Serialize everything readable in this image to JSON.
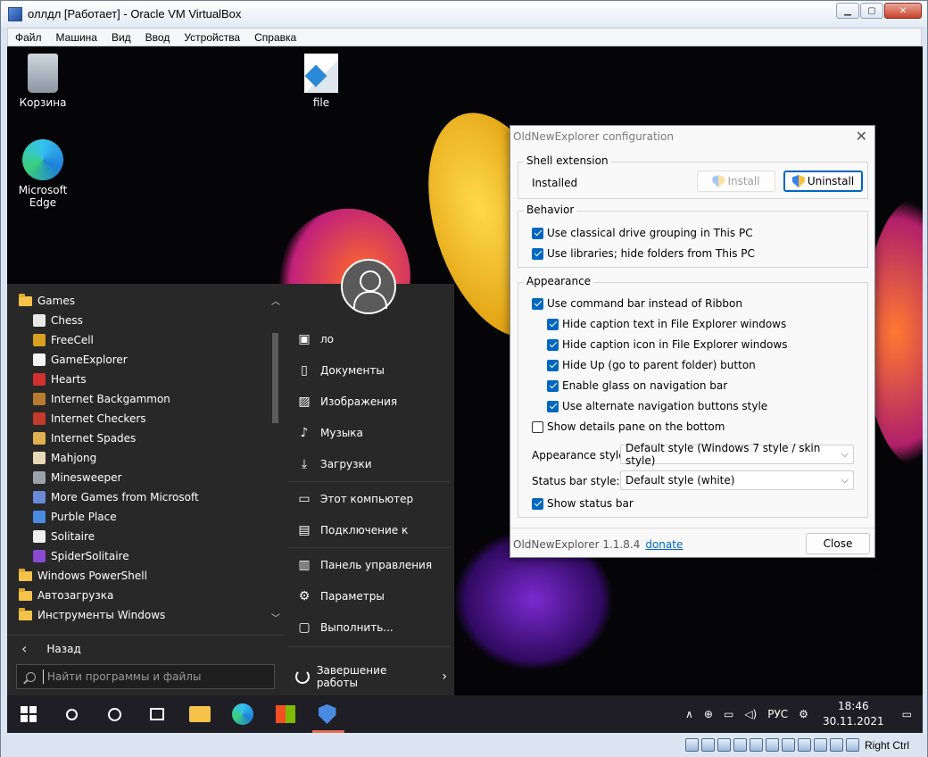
{
  "host": {
    "title": "оллдл [Работает] - Oracle VM VirtualBox",
    "menu": [
      "Файл",
      "Машина",
      "Вид",
      "Ввод",
      "Устройства",
      "Справка"
    ],
    "host_key": "Right Ctrl"
  },
  "desktop": {
    "icons": [
      {
        "label": "Корзина"
      },
      {
        "label": "file"
      },
      {
        "label": "Microsoft Edge"
      }
    ]
  },
  "start_menu": {
    "items": [
      {
        "label": "Games",
        "type": "folder"
      },
      {
        "label": "Chess",
        "type": "game"
      },
      {
        "label": "FreeCell",
        "type": "game"
      },
      {
        "label": "GameExplorer",
        "type": "game"
      },
      {
        "label": "Hearts",
        "type": "game"
      },
      {
        "label": "Internet Backgammon",
        "type": "game"
      },
      {
        "label": "Internet Checkers",
        "type": "game"
      },
      {
        "label": "Internet Spades",
        "type": "game"
      },
      {
        "label": "Mahjong",
        "type": "game"
      },
      {
        "label": "Minesweeper",
        "type": "game"
      },
      {
        "label": "More Games from Microsoft",
        "type": "game"
      },
      {
        "label": "Purble Place",
        "type": "game"
      },
      {
        "label": "Solitaire",
        "type": "game"
      },
      {
        "label": "SpiderSolitaire",
        "type": "game"
      },
      {
        "label": "Windows PowerShell",
        "type": "folder"
      },
      {
        "label": "Автозагрузка",
        "type": "folder"
      },
      {
        "label": "Инструменты Windows",
        "type": "folder"
      }
    ],
    "back_label": "Назад",
    "search_placeholder": "Найти программы и файлы",
    "places": [
      {
        "label": "ло",
        "icon": "user-folder-icon"
      },
      {
        "label": "Документы",
        "icon": "document-icon"
      },
      {
        "label": "Изображения",
        "icon": "image-icon"
      },
      {
        "label": "Музыка",
        "icon": "music-icon"
      },
      {
        "label": "Загрузки",
        "icon": "download-icon"
      },
      {
        "label": "Этот компьютер",
        "icon": "computer-icon"
      },
      {
        "label": "Подключение к",
        "icon": "connect-icon"
      },
      {
        "label": "Панель управления",
        "icon": "control-panel-icon"
      },
      {
        "label": "Параметры",
        "icon": "gear-icon"
      },
      {
        "label": "Выполнить...",
        "icon": "run-icon"
      }
    ],
    "shutdown_label": "Завершение работы"
  },
  "taskbar": {
    "language": "РУС",
    "time": "18:46",
    "date": "30.11.2021"
  },
  "dialog": {
    "title": "OldNewExplorer configuration",
    "shell_extension": {
      "legend": "Shell extension",
      "status": "Installed",
      "install_label": "Install",
      "uninstall_label": "Uninstall"
    },
    "behavior": {
      "legend": "Behavior",
      "options": [
        {
          "label": "Use classical drive grouping in This PC",
          "checked": true
        },
        {
          "label": "Use libraries; hide folders from This PC",
          "checked": true
        }
      ]
    },
    "appearance": {
      "legend": "Appearance",
      "options": [
        {
          "label": "Use command bar instead of Ribbon",
          "checked": true
        },
        {
          "label": "Hide caption text in File Explorer windows",
          "checked": true
        },
        {
          "label": "Hide caption icon in File Explorer windows",
          "checked": true
        },
        {
          "label": "Hide Up (go to parent folder) button",
          "checked": true
        },
        {
          "label": "Enable glass on navigation bar",
          "checked": true
        },
        {
          "label": "Use alternate navigation buttons style",
          "checked": true
        },
        {
          "label": "Show details pane on the bottom",
          "checked": false
        }
      ],
      "style_label": "Appearance style:",
      "style_value": "Default style (Windows 7 style / skin style)",
      "statusbar_label": "Status bar style:",
      "statusbar_value": "Default style (white)",
      "show_status_bar": {
        "label": "Show status bar",
        "checked": true
      }
    },
    "version": "OldNewExplorer 1.1.8.4",
    "donate": "donate",
    "close_label": "Close"
  }
}
